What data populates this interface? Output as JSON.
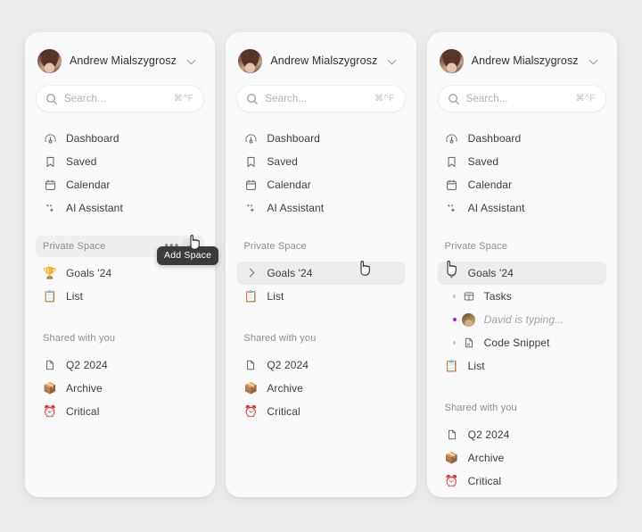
{
  "app": {
    "background_color": "#ebebeb",
    "panel_color": "#fafafa",
    "accent_color": "#9c27d6",
    "tooltip_bg": "#3b3b3b"
  },
  "user": {
    "name": "Andrew Mialszygrosz",
    "avatar_icon": "user-avatar-photo",
    "chevron_icon": "chevron-down-icon"
  },
  "search": {
    "placeholder": "Search...",
    "shortcut": "⌘^F",
    "icon": "search-icon"
  },
  "nav": {
    "items": [
      {
        "label": "Dashboard",
        "icon": "gauge-icon"
      },
      {
        "label": "Saved",
        "icon": "bookmark-icon"
      },
      {
        "label": "Calendar",
        "icon": "calendar-icon"
      },
      {
        "label": "AI Assistant",
        "icon": "sparkles-icon"
      }
    ]
  },
  "private_space": {
    "title": "Private Space",
    "more_icon": "ellipsis-icon",
    "add_icon": "plus-icon",
    "add_tooltip": "Add Space",
    "items": [
      {
        "label": "Goals '24",
        "icon": "trophy-emoji",
        "emoji": "🏆"
      },
      {
        "label": "List",
        "icon": "clipboard-emoji",
        "emoji": "📋"
      }
    ],
    "goals_children": [
      {
        "label": "Tasks",
        "icon": "table-icon",
        "active": false
      },
      {
        "label": "David is typing...",
        "icon": "user-avatar-mini",
        "active": true
      },
      {
        "label": "Code Snippet",
        "icon": "file-code-icon",
        "active": false
      }
    ]
  },
  "shared": {
    "title": "Shared with you",
    "items": [
      {
        "label": "Q2 2024",
        "icon": "file-icon",
        "emoji": ""
      },
      {
        "label": "Archive",
        "icon": "package-emoji",
        "emoji": "📦"
      },
      {
        "label": "Critical",
        "icon": "alarm-clock-emoji",
        "emoji": "⏰"
      }
    ]
  },
  "panels": [
    {
      "id": "panel-1",
      "state": "add-space-tooltip"
    },
    {
      "id": "panel-2",
      "state": "goals-hovered-collapsed"
    },
    {
      "id": "panel-3",
      "state": "goals-expanded"
    }
  ]
}
